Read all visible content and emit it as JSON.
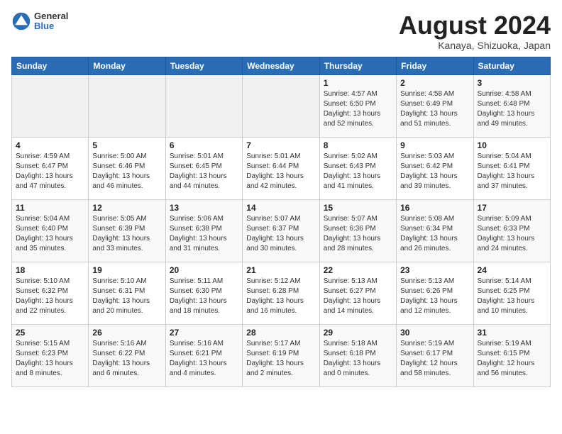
{
  "header": {
    "logo": {
      "general": "General",
      "blue": "Blue"
    },
    "title": "August 2024",
    "location": "Kanaya, Shizuoka, Japan"
  },
  "weekdays": [
    "Sunday",
    "Monday",
    "Tuesday",
    "Wednesday",
    "Thursday",
    "Friday",
    "Saturday"
  ],
  "weeks": [
    [
      {
        "day": "",
        "info": ""
      },
      {
        "day": "",
        "info": ""
      },
      {
        "day": "",
        "info": ""
      },
      {
        "day": "",
        "info": ""
      },
      {
        "day": "1",
        "info": "Sunrise: 4:57 AM\nSunset: 6:50 PM\nDaylight: 13 hours\nand 52 minutes."
      },
      {
        "day": "2",
        "info": "Sunrise: 4:58 AM\nSunset: 6:49 PM\nDaylight: 13 hours\nand 51 minutes."
      },
      {
        "day": "3",
        "info": "Sunrise: 4:58 AM\nSunset: 6:48 PM\nDaylight: 13 hours\nand 49 minutes."
      }
    ],
    [
      {
        "day": "4",
        "info": "Sunrise: 4:59 AM\nSunset: 6:47 PM\nDaylight: 13 hours\nand 47 minutes."
      },
      {
        "day": "5",
        "info": "Sunrise: 5:00 AM\nSunset: 6:46 PM\nDaylight: 13 hours\nand 46 minutes."
      },
      {
        "day": "6",
        "info": "Sunrise: 5:01 AM\nSunset: 6:45 PM\nDaylight: 13 hours\nand 44 minutes."
      },
      {
        "day": "7",
        "info": "Sunrise: 5:01 AM\nSunset: 6:44 PM\nDaylight: 13 hours\nand 42 minutes."
      },
      {
        "day": "8",
        "info": "Sunrise: 5:02 AM\nSunset: 6:43 PM\nDaylight: 13 hours\nand 41 minutes."
      },
      {
        "day": "9",
        "info": "Sunrise: 5:03 AM\nSunset: 6:42 PM\nDaylight: 13 hours\nand 39 minutes."
      },
      {
        "day": "10",
        "info": "Sunrise: 5:04 AM\nSunset: 6:41 PM\nDaylight: 13 hours\nand 37 minutes."
      }
    ],
    [
      {
        "day": "11",
        "info": "Sunrise: 5:04 AM\nSunset: 6:40 PM\nDaylight: 13 hours\nand 35 minutes."
      },
      {
        "day": "12",
        "info": "Sunrise: 5:05 AM\nSunset: 6:39 PM\nDaylight: 13 hours\nand 33 minutes."
      },
      {
        "day": "13",
        "info": "Sunrise: 5:06 AM\nSunset: 6:38 PM\nDaylight: 13 hours\nand 31 minutes."
      },
      {
        "day": "14",
        "info": "Sunrise: 5:07 AM\nSunset: 6:37 PM\nDaylight: 13 hours\nand 30 minutes."
      },
      {
        "day": "15",
        "info": "Sunrise: 5:07 AM\nSunset: 6:36 PM\nDaylight: 13 hours\nand 28 minutes."
      },
      {
        "day": "16",
        "info": "Sunrise: 5:08 AM\nSunset: 6:34 PM\nDaylight: 13 hours\nand 26 minutes."
      },
      {
        "day": "17",
        "info": "Sunrise: 5:09 AM\nSunset: 6:33 PM\nDaylight: 13 hours\nand 24 minutes."
      }
    ],
    [
      {
        "day": "18",
        "info": "Sunrise: 5:10 AM\nSunset: 6:32 PM\nDaylight: 13 hours\nand 22 minutes."
      },
      {
        "day": "19",
        "info": "Sunrise: 5:10 AM\nSunset: 6:31 PM\nDaylight: 13 hours\nand 20 minutes."
      },
      {
        "day": "20",
        "info": "Sunrise: 5:11 AM\nSunset: 6:30 PM\nDaylight: 13 hours\nand 18 minutes."
      },
      {
        "day": "21",
        "info": "Sunrise: 5:12 AM\nSunset: 6:28 PM\nDaylight: 13 hours\nand 16 minutes."
      },
      {
        "day": "22",
        "info": "Sunrise: 5:13 AM\nSunset: 6:27 PM\nDaylight: 13 hours\nand 14 minutes."
      },
      {
        "day": "23",
        "info": "Sunrise: 5:13 AM\nSunset: 6:26 PM\nDaylight: 13 hours\nand 12 minutes."
      },
      {
        "day": "24",
        "info": "Sunrise: 5:14 AM\nSunset: 6:25 PM\nDaylight: 13 hours\nand 10 minutes."
      }
    ],
    [
      {
        "day": "25",
        "info": "Sunrise: 5:15 AM\nSunset: 6:23 PM\nDaylight: 13 hours\nand 8 minutes."
      },
      {
        "day": "26",
        "info": "Sunrise: 5:16 AM\nSunset: 6:22 PM\nDaylight: 13 hours\nand 6 minutes."
      },
      {
        "day": "27",
        "info": "Sunrise: 5:16 AM\nSunset: 6:21 PM\nDaylight: 13 hours\nand 4 minutes."
      },
      {
        "day": "28",
        "info": "Sunrise: 5:17 AM\nSunset: 6:19 PM\nDaylight: 13 hours\nand 2 minutes."
      },
      {
        "day": "29",
        "info": "Sunrise: 5:18 AM\nSunset: 6:18 PM\nDaylight: 13 hours\nand 0 minutes."
      },
      {
        "day": "30",
        "info": "Sunrise: 5:19 AM\nSunset: 6:17 PM\nDaylight: 12 hours\nand 58 minutes."
      },
      {
        "day": "31",
        "info": "Sunrise: 5:19 AM\nSunset: 6:15 PM\nDaylight: 12 hours\nand 56 minutes."
      }
    ]
  ]
}
